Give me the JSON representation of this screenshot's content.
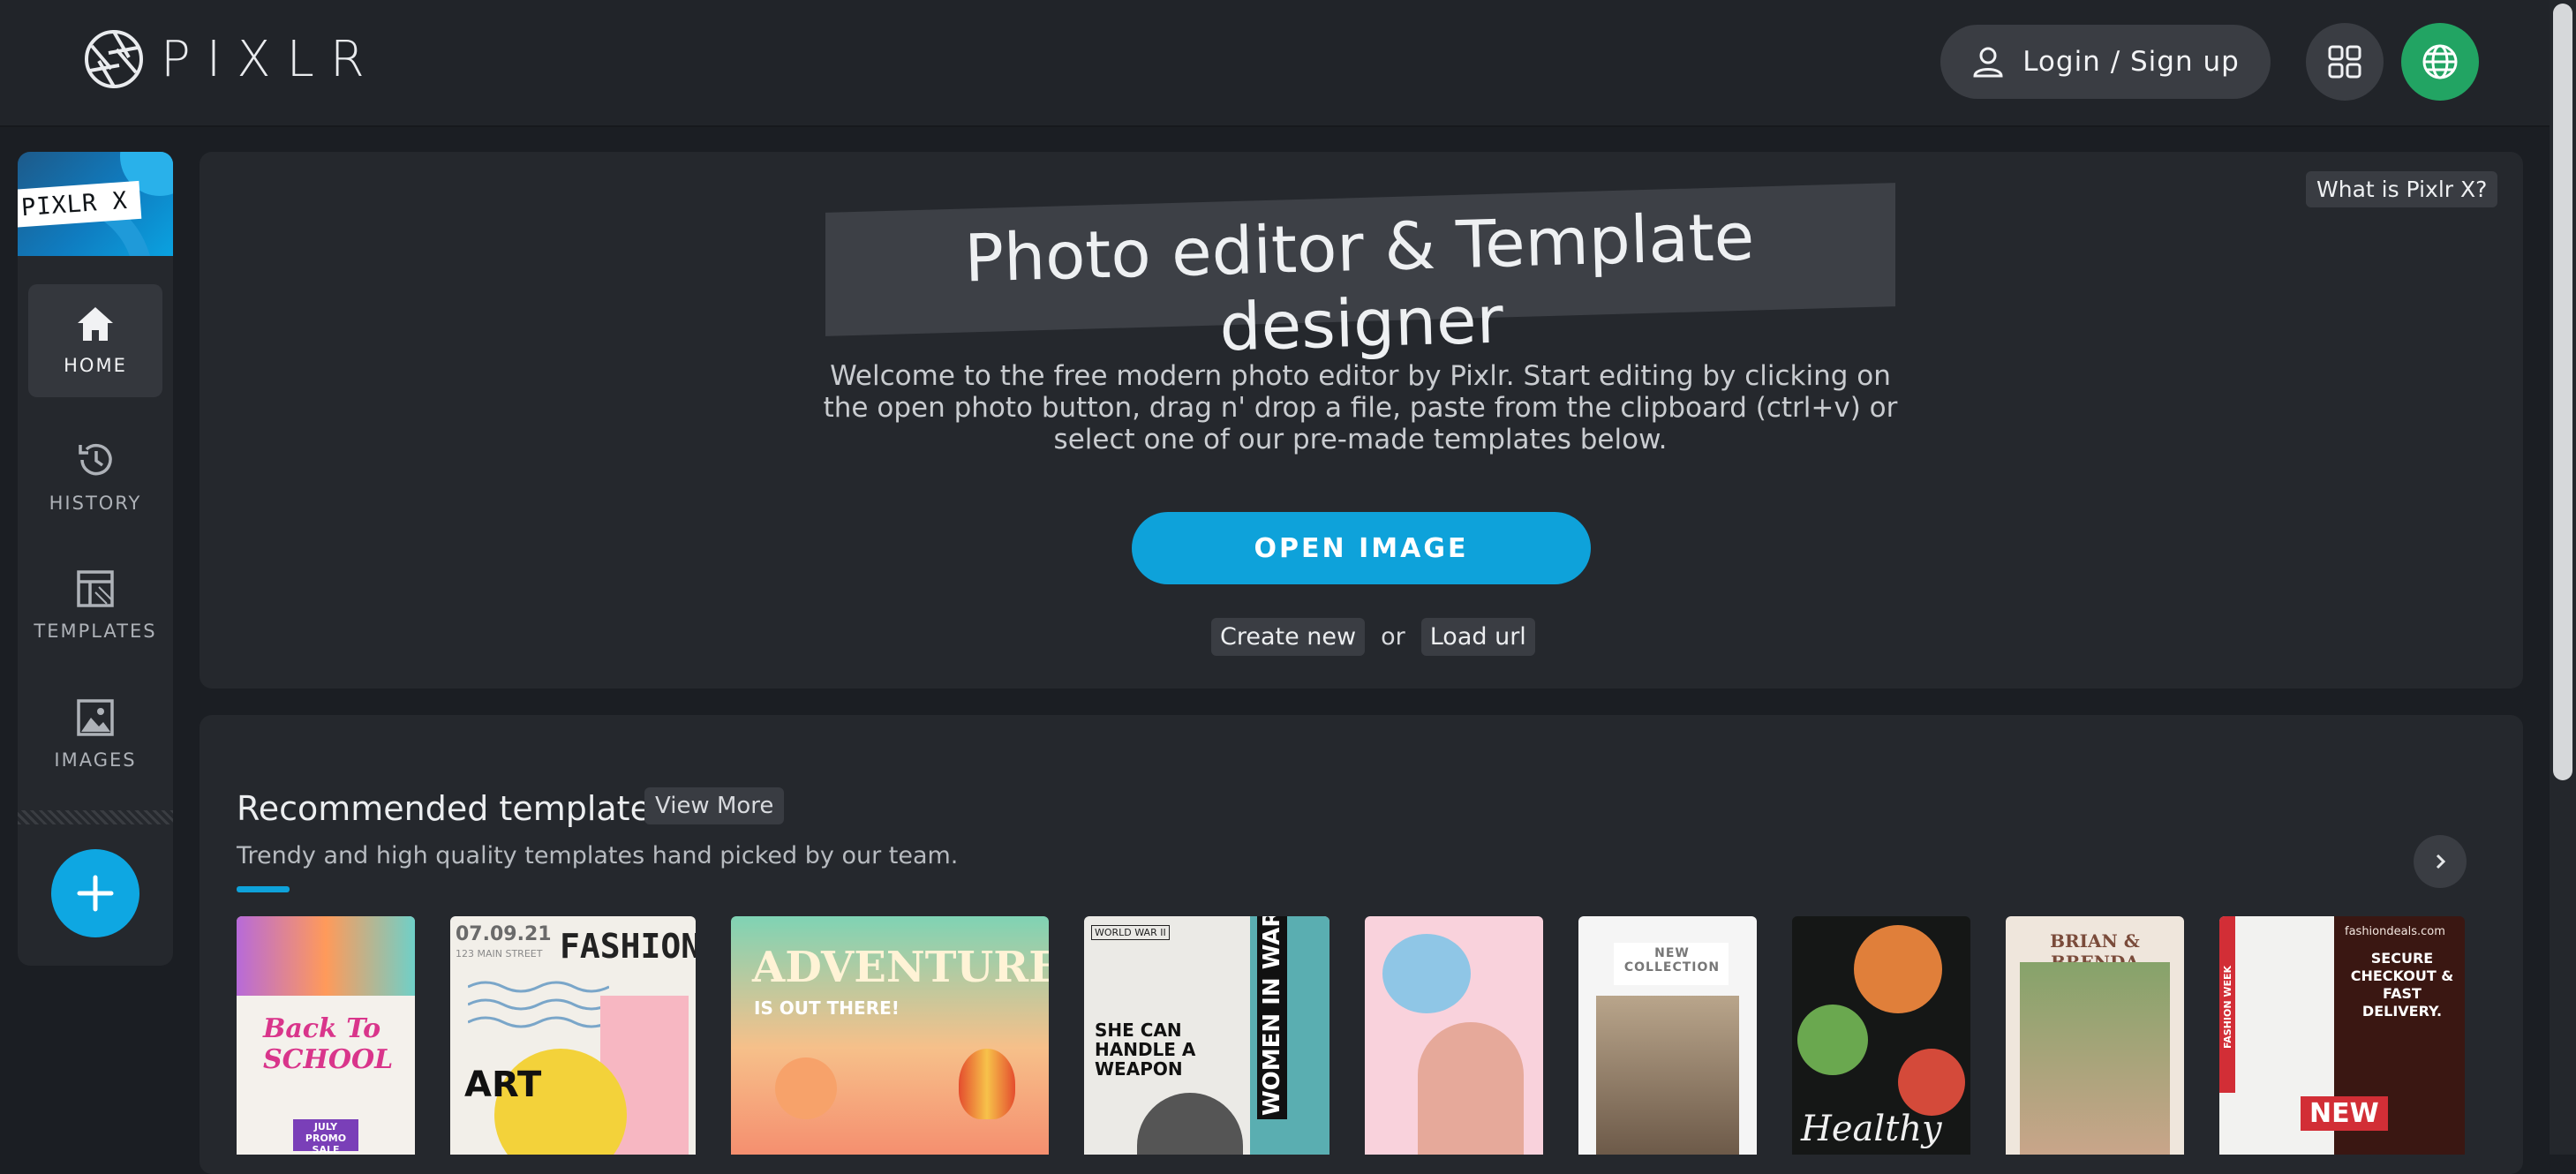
{
  "brand": {
    "name": "PIXLR"
  },
  "header": {
    "login_label": "Login / Sign up",
    "apps_icon": "grid-icon",
    "language_icon": "globe-icon",
    "colors": {
      "language_button": "#22a463"
    }
  },
  "sidebar": {
    "brand_tag": "PIXLR X",
    "items": [
      {
        "label": "HOME",
        "icon": "home-icon",
        "active": true
      },
      {
        "label": "HISTORY",
        "icon": "history-icon",
        "active": false
      },
      {
        "label": "TEMPLATES",
        "icon": "templates-icon",
        "active": false
      },
      {
        "label": "IMAGES",
        "icon": "image-icon",
        "active": false
      }
    ],
    "add_icon": "plus-icon"
  },
  "hero": {
    "what_label": "What is Pixlr X?",
    "title": "Photo editor & Template designer",
    "description": "Welcome to the free modern photo editor by Pixlr. Start editing by clicking on the open photo button, drag n' drop a file, paste from the clipboard (ctrl+v) or select one of our pre-made templates below.",
    "open_label": "OPEN IMAGE",
    "create_label": "Create new",
    "or_label": "or",
    "load_label": "Load url",
    "accent_color": "#0ea2da"
  },
  "recommended": {
    "title": "Recommended templates",
    "view_more": "View More",
    "subtitle": "Trendy and high quality templates hand picked by our team.",
    "next_icon": "chevron-right-icon",
    "cards": [
      {
        "text": "Back To SCHOOL",
        "sub": "JULY PROMO SALE"
      },
      {
        "text": "FASHION",
        "sub": "07.09.21",
        "extra": "123 MAIN STREET",
        "extra2": "ART"
      },
      {
        "text": "ADVENTURE",
        "sub": "IS OUT THERE!"
      },
      {
        "text": "WOMEN IN WAR",
        "sub": "SHE CAN HANDLE A WEAPON",
        "extra": "WORLD WAR II"
      },
      {
        "text": ""
      },
      {
        "text": "NEW COLLECTION"
      },
      {
        "text": "Healthy"
      },
      {
        "text": "BRIAN & BRENDA"
      },
      {
        "text": "NEW",
        "sub": "SECURE CHECKOUT & FAST DELIVERY.",
        "extra": "fashiondeals.com",
        "extra2": "FASHION WEEK"
      }
    ]
  }
}
